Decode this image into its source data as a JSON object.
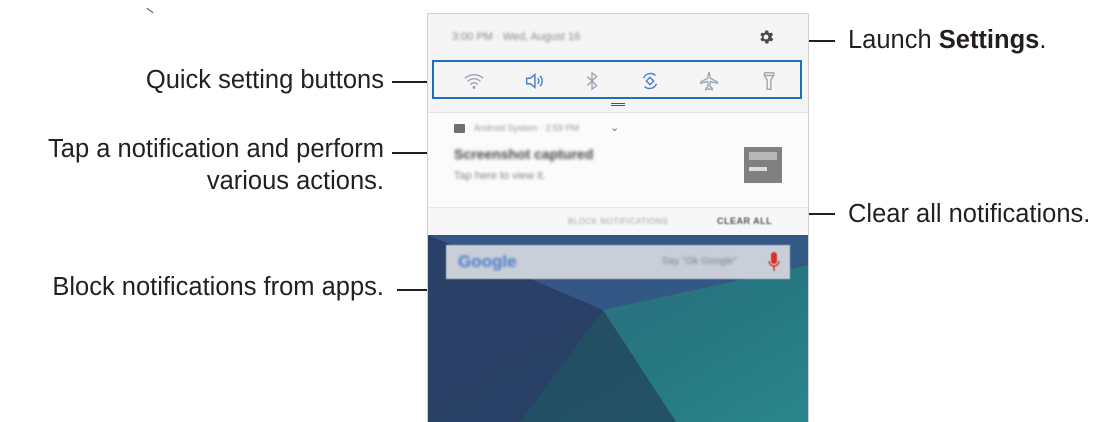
{
  "annotations": {
    "launch_prefix": "Launch ",
    "launch_bold": "Settings",
    "launch_suffix": ".",
    "quick_settings": "Quick setting buttons",
    "tap_line1": "Tap a notification and perform",
    "tap_line2": "various actions.",
    "clear_all": "Clear all notifications.",
    "block": "Block notifications from apps."
  },
  "panel": {
    "status_text": "3:00 PM  ·  Wed, August 16",
    "quick_settings_icons": [
      "wifi-icon",
      "sound-icon",
      "bluetooth-icon",
      "auto-rotate-icon",
      "airplane-mode-icon",
      "flashlight-icon"
    ],
    "notification": {
      "meta": "Android System  ·  2:59 PM",
      "title": "Screenshot captured",
      "body": "Tap here to view it."
    },
    "block_label": "BLOCK NOTIFICATIONS",
    "clear_label": "CLEAR ALL",
    "search_brand": "Google",
    "search_hint": "Say \"Ok Google\""
  },
  "colors": {
    "highlight_border": "#1f6fb8",
    "text": "#231f20",
    "mic": "#d93025"
  }
}
